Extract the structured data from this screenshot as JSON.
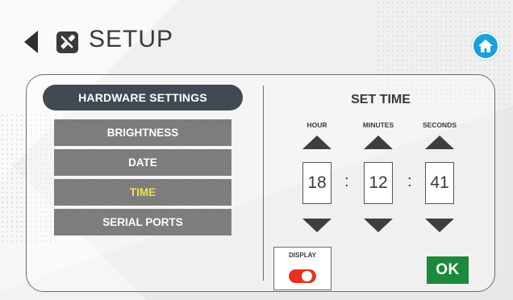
{
  "header": {
    "title": "SETUP",
    "back_icon": "left-triangle",
    "setup_icon": "wrench-screwdriver-icon",
    "home_icon": "home-icon",
    "home_color": "#1aa0dc"
  },
  "sidebar": {
    "header": "HARDWARE SETTINGS",
    "items": [
      {
        "label": "BRIGHTNESS",
        "active": false
      },
      {
        "label": "DATE",
        "active": false
      },
      {
        "label": "TIME",
        "active": true
      },
      {
        "label": "SERIAL PORTS",
        "active": false
      }
    ],
    "active_color": "#f5e14a"
  },
  "time_panel": {
    "title": "SET TIME",
    "hour_label": "HOUR",
    "minutes_label": "MINUTES",
    "seconds_label": "SECONDS",
    "hour": "18",
    "minutes": "12",
    "seconds": "41",
    "separator": ":"
  },
  "display": {
    "label": "DISPLAY",
    "toggle_on": false,
    "toggle_color": "#e8311f"
  },
  "ok_label": "OK",
  "ok_color": "#1b8a3a"
}
